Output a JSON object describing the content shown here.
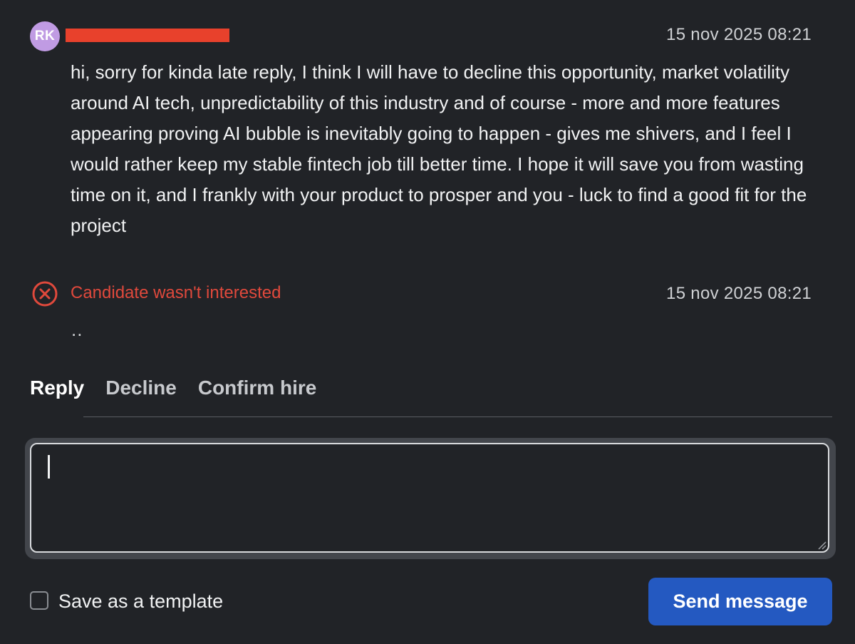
{
  "message": {
    "avatar_initials": "RK",
    "timestamp": "15 nov 2025 08:21",
    "body": "hi, sorry for kinda late reply, I think I will have to decline this opportunity, market volatility around AI tech, unpredictability of this industry and of course - more and more features appearing proving AI bubble is inevitably going to happen - gives me shivers, and I feel I would rather keep my stable fintech job till better time. I hope it will save you from wasting time on it, and I frankly with your product to prosper and you - luck to find a good fit for the project"
  },
  "status_event": {
    "icon": "x-circle-icon",
    "text": "Candidate wasn't interested",
    "timestamp": "15 nov 2025 08:21",
    "note": ".."
  },
  "tabs": [
    {
      "label": "Reply",
      "active": true
    },
    {
      "label": "Decline",
      "active": false
    },
    {
      "label": "Confirm hire",
      "active": false
    }
  ],
  "composer": {
    "value": ""
  },
  "footer": {
    "template_checkbox_label": "Save as a template",
    "template_checked": false,
    "send_label": "Send message"
  },
  "colors": {
    "background": "#212327",
    "avatar": "#c09be3",
    "redaction": "#e8412c",
    "status_error": "#e0493c",
    "primary_button": "#2459c1"
  }
}
